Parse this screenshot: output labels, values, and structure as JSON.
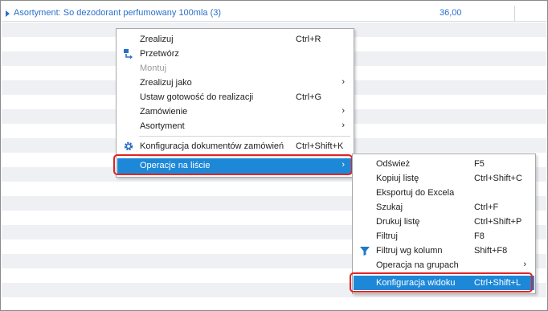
{
  "group_row": {
    "label": "Asortyment: So dezodorant perfumowany 100mla (3)",
    "value": "36,00"
  },
  "menu1": {
    "items": [
      {
        "label": "Zrealizuj",
        "shortcut": "Ctrl+R"
      },
      {
        "label": "Przetwórz",
        "shortcut": "",
        "icon": "process-icon"
      },
      {
        "label": "Montuj",
        "shortcut": "",
        "disabled": true
      },
      {
        "label": "Zrealizuj jako",
        "shortcut": "",
        "submenu_arrow": "›"
      },
      {
        "label": "Ustaw gotowość do realizacji",
        "shortcut": "Ctrl+G"
      },
      {
        "label": "Zamówienie",
        "shortcut": "",
        "submenu_arrow": "›"
      },
      {
        "label": "Asortyment",
        "shortcut": "",
        "submenu_arrow": "›"
      },
      {
        "label": "Konfiguracja dokumentów zamówień",
        "shortcut": "Ctrl+Shift+K",
        "icon": "gear-icon"
      },
      {
        "label": "Operacje na liście",
        "shortcut": "",
        "submenu_arrow": "›",
        "selected": true
      }
    ]
  },
  "menu2": {
    "items": [
      {
        "label": "Odśwież",
        "shortcut": "F5"
      },
      {
        "label": "Kopiuj listę",
        "shortcut": "Ctrl+Shift+C"
      },
      {
        "label": "Eksportuj do Excela",
        "shortcut": ""
      },
      {
        "label": "Szukaj",
        "shortcut": "Ctrl+F"
      },
      {
        "label": "Drukuj listę",
        "shortcut": "Ctrl+Shift+P"
      },
      {
        "label": "Filtruj",
        "shortcut": "F8"
      },
      {
        "label": "Filtruj wg kolumn",
        "shortcut": "Shift+F8",
        "icon": "filter-icon"
      },
      {
        "label": "Operacja na grupach",
        "shortcut": "",
        "submenu_arrow": "›"
      },
      {
        "label": "Konfiguracja widoku",
        "shortcut": "Ctrl+Shift+L",
        "selected": true
      }
    ]
  },
  "colors": {
    "selected_bg": "#1e88d8",
    "highlight_border": "#e02424",
    "group_text": "#2a6fc9",
    "alt_row": "#eef0f4"
  }
}
